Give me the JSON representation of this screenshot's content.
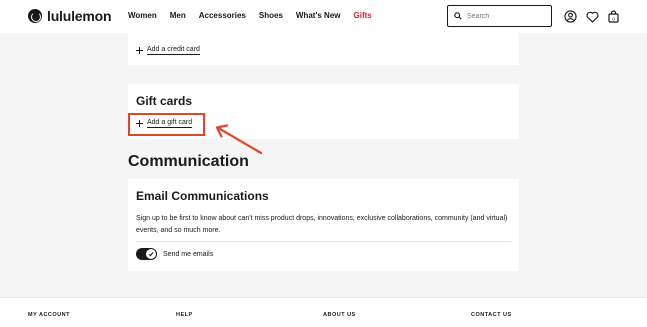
{
  "header": {
    "logo_text": "lululemon",
    "nav": [
      "Women",
      "Men",
      "Accessories",
      "Shoes",
      "What's New",
      "Gifts"
    ],
    "search_placeholder": "Search"
  },
  "credit": {
    "add_label": "Add a credit card"
  },
  "gift_cards": {
    "title": "Gift cards",
    "add_label": "Add a gift card"
  },
  "communication": {
    "title": "Communication",
    "email_title": "Email Communications",
    "email_desc": "Sign up to be first to know about can't miss product drops, innovations, exclusive collaborations, community (and virtual) events, and so much more.",
    "toggle_label": "Send me emails",
    "toggle_on": true
  },
  "footer": {
    "columns": [
      "MY ACCOUNT",
      "HELP",
      "ABOUT US",
      "CONTACT US"
    ]
  },
  "colors": {
    "accent_gifts": "#d22030",
    "annotation": "#e0472a"
  }
}
